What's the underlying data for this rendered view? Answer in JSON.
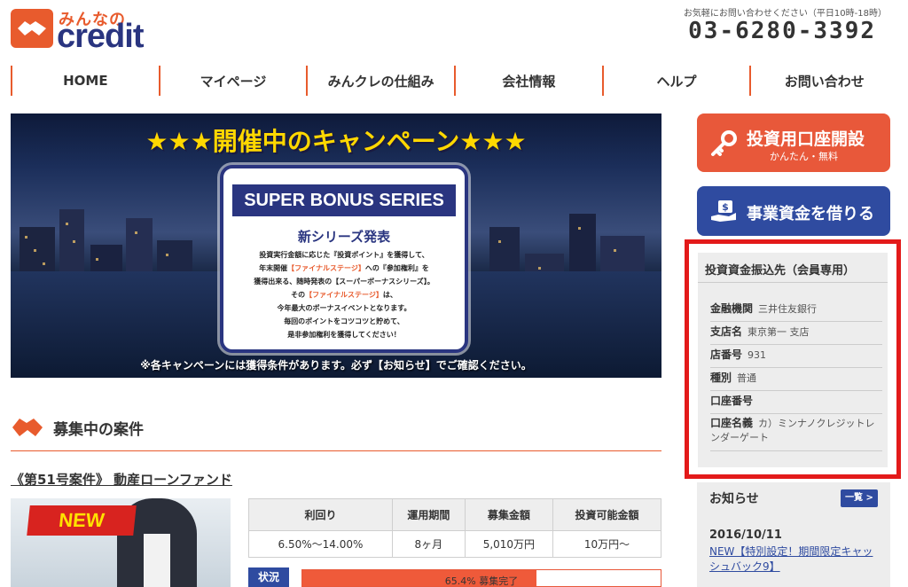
{
  "header": {
    "logo_top": "みんなの",
    "logo_bottom": "credit",
    "contact_note": "お気軽にお問い合わせください（平日10時-18時）",
    "phone": "03-6280-3392"
  },
  "nav": {
    "items": [
      "HOME",
      "マイページ",
      "みんクレの仕組み",
      "会社情報",
      "ヘルプ",
      "お問い合わせ"
    ]
  },
  "banner": {
    "heading": "★★★開催中のキャンペーン★★★",
    "card_title": "SUPER BONUS SERIES",
    "card_subtitle": "新シリーズ発表",
    "lines": [
      {
        "a": "投資実行金額に応じた『投資ポイント』を獲得して、",
        "hl": "",
        "b": ""
      },
      {
        "a": "年末開催",
        "hl": "【ファイナルステージ】",
        "b": "への『参加権利』を"
      },
      {
        "a": "獲得出来る、随時発表の【スーパーボーナスシリーズ】。",
        "hl": "",
        "b": ""
      },
      {
        "a": "その",
        "hl": "【ファイナルステージ】",
        "b": "は、"
      },
      {
        "a": "今年最大のボーナスイベントとなります。",
        "hl": "",
        "b": ""
      },
      {
        "a": "毎回のポイントをコツコツと貯めて、",
        "hl": "",
        "b": ""
      },
      {
        "a": "是非参加権利を獲得してください！",
        "hl": "",
        "b": ""
      }
    ],
    "notice": "※各キャンペーンには獲得条件があります。必ず【お知らせ】でご確認ください。"
  },
  "sidebar": {
    "open_account_label": "投資用口座開設",
    "open_account_sub": "かんたん・無料",
    "borrow_label": "事業資金を借りる",
    "bank": {
      "title": "投資資金振込先（会員専用）",
      "rows": [
        {
          "key": "金融機関",
          "value": "三井住友銀行"
        },
        {
          "key": "支店名",
          "value": "東京第一 支店"
        },
        {
          "key": "店番号",
          "value": "931"
        },
        {
          "key": "種別",
          "value": "普通"
        },
        {
          "key": "口座番号",
          "value": ""
        },
        {
          "key": "口座名義",
          "value": "カ）ミンナノクレジットレンダーゲート"
        }
      ]
    },
    "news": {
      "title": "お知らせ",
      "all_label": "一覧 >",
      "date": "2016/10/11",
      "link": "NEW【特別設定！期間限定キャッシュバック9】"
    }
  },
  "recruit": {
    "title": "募集中の案件",
    "fund_title": "《第51号案件》 動産ローンファンド",
    "badge": "NEW",
    "table": {
      "headers": [
        "利回り",
        "運用期間",
        "募集金額",
        "投資可能金額"
      ],
      "values": [
        "6.50%～14.00%",
        "8ヶ月",
        "5,010万円",
        "10万円～"
      ]
    },
    "status_label": "状況",
    "progress_fraction": 0.654,
    "progress_text": "65.4% 募集完了"
  }
}
